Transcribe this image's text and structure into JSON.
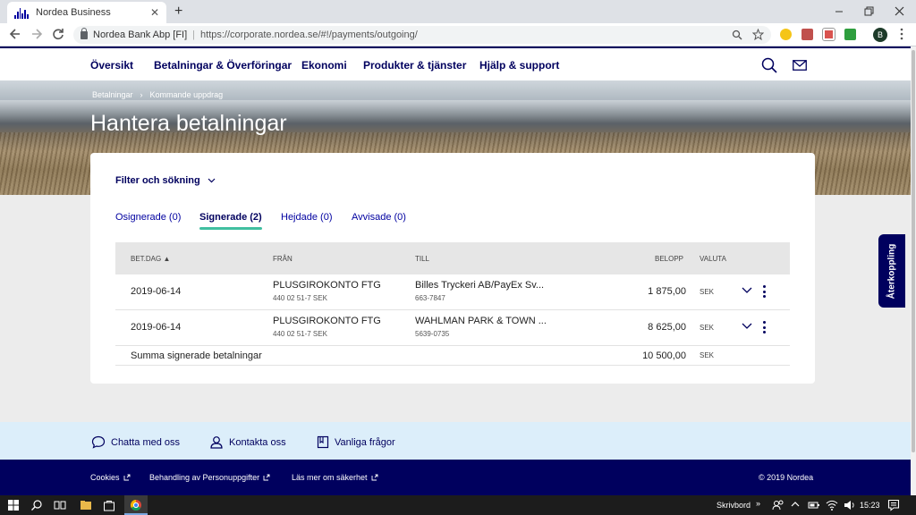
{
  "browser": {
    "tab_title": "Nordea Business",
    "close_glyph": "✕",
    "new_tab_glyph": "+",
    "site_identity": "Nordea Bank Abp [FI]",
    "url": "https://corporate.nordea.se/#!/payments/outgoing/",
    "profile_initial": "B"
  },
  "nav": {
    "items": [
      "Översikt",
      "Betalningar & Överföringar",
      "Ekonomi",
      "Produkter & tjänster",
      "Hjälp & support"
    ]
  },
  "breadcrumb": {
    "items": [
      "Betalningar",
      "Kommande uppdrag"
    ]
  },
  "page": {
    "title": "Hantera betalningar"
  },
  "filter": {
    "label": "Filter och sökning"
  },
  "subtabs": [
    {
      "label": "Osignerade (0)"
    },
    {
      "label": "Signerade (2)"
    },
    {
      "label": "Hejdade (0)"
    },
    {
      "label": "Avvisade (0)"
    }
  ],
  "table": {
    "headers": [
      "BET.DAG ▲",
      "FRÅN",
      "TILL",
      "BELOPP",
      "VALUTA"
    ],
    "rows": [
      {
        "date": "2019-06-14",
        "from_name": "PLUSGIROKONTO FTG",
        "from_account": "440 02 51-7 SEK",
        "to_name": "Billes Tryckeri AB/PayEx Sv...",
        "to_account": "663-7847",
        "amount": "1 875,00",
        "currency": "SEK"
      },
      {
        "date": "2019-06-14",
        "from_name": "PLUSGIROKONTO FTG",
        "from_account": "440 02 51-7 SEK",
        "to_name": "WAHLMAN PARK & TOWN ...",
        "to_account": "5639-0735",
        "amount": "8 625,00",
        "currency": "SEK"
      }
    ],
    "summary": {
      "label": "Summa signerade betalningar",
      "amount": "10 500,00",
      "currency": "SEK"
    }
  },
  "feedback": {
    "label": "Återkoppling"
  },
  "help": {
    "items": [
      "Chatta med oss",
      "Kontakta oss",
      "Vanliga frågor"
    ]
  },
  "footer": {
    "links": [
      "Cookies",
      "Behandling av Personuppgifter",
      "Läs mer om säkerhet"
    ],
    "copyright": "© 2019 Nordea"
  },
  "taskbar": {
    "desktop_label": "Skrivbord",
    "chevron": "»",
    "time": "15:23"
  },
  "colors": {
    "brand": "#00005e",
    "accent": "#0000a0",
    "active_underline": "#40bfa0",
    "help_bar": "#dceefa"
  }
}
